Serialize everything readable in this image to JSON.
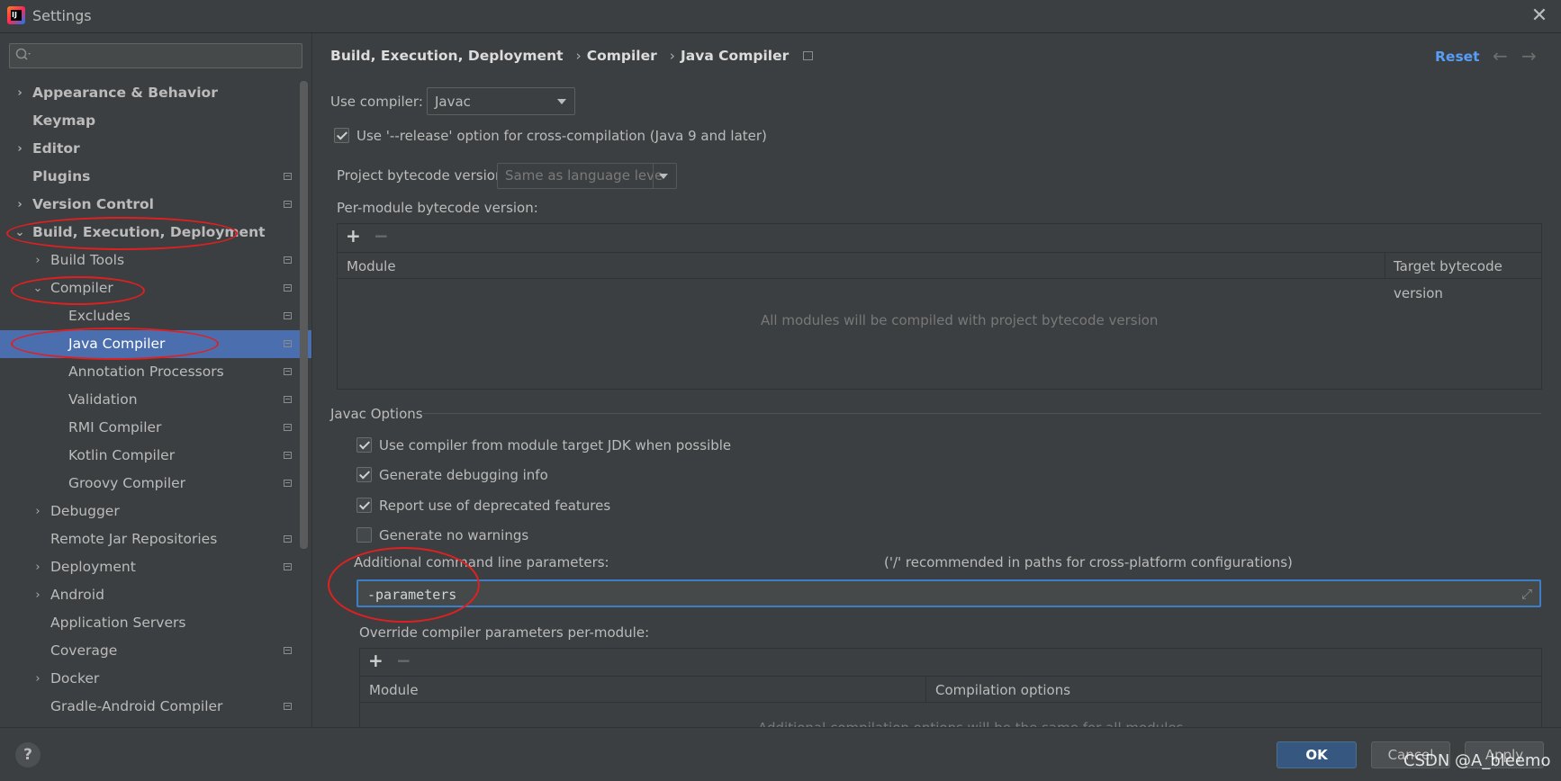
{
  "window": {
    "title": "Settings",
    "close_glyph": "✕",
    "app_icon_text": "IJ"
  },
  "search": {
    "value": "",
    "placeholder": "",
    "icon": "search-icon"
  },
  "sidebar": {
    "items": [
      {
        "label": "Appearance & Behavior",
        "chevron": "›"
      },
      {
        "label": "Keymap"
      },
      {
        "label": "Editor",
        "chevron": "›"
      },
      {
        "label": "Plugins"
      },
      {
        "label": "Version Control",
        "chevron": "›"
      },
      {
        "label": "Build, Execution, Deployment",
        "chevron": "⌄"
      },
      {
        "label": "Build Tools",
        "chevron": "›"
      },
      {
        "label": "Compiler",
        "chevron": "⌄"
      },
      {
        "label": "Excludes"
      },
      {
        "label": "Java Compiler"
      },
      {
        "label": "Annotation Processors"
      },
      {
        "label": "Validation"
      },
      {
        "label": "RMI Compiler"
      },
      {
        "label": "Kotlin Compiler"
      },
      {
        "label": "Groovy Compiler"
      },
      {
        "label": "Debugger",
        "chevron": "›"
      },
      {
        "label": "Remote Jar Repositories"
      },
      {
        "label": "Deployment",
        "chevron": "›"
      },
      {
        "label": "Android",
        "chevron": "›"
      },
      {
        "label": "Application Servers"
      },
      {
        "label": "Coverage"
      },
      {
        "label": "Docker",
        "chevron": "›"
      },
      {
        "label": "Gradle-Android Compiler"
      }
    ],
    "selected": "Java Compiler"
  },
  "breadcrumb": {
    "items": [
      "Build, Execution, Deployment",
      "Compiler",
      "Java Compiler"
    ],
    "separator": "›"
  },
  "header": {
    "reset_label": "Reset",
    "back_glyph": "←",
    "forward_glyph": "→"
  },
  "compiler": {
    "use_compiler_label": "Use compiler:",
    "use_compiler_value": "Javac",
    "release_option_label": "Use '--release' option for cross-compilation (Java 9 and later)",
    "release_option_checked": true,
    "bytecode_label": "Project bytecode version:",
    "bytecode_value": "Same as language leve",
    "per_module_label": "Per-module bytecode version:",
    "module_table": {
      "columns": [
        "Module",
        "Target bytecode version"
      ],
      "empty_text": "All modules will be compiled with project bytecode version"
    }
  },
  "javac": {
    "section_title": "Javac Options",
    "options": [
      {
        "label": "Use compiler from module target JDK when possible",
        "checked": true
      },
      {
        "label": "Generate debugging info",
        "checked": true
      },
      {
        "label": "Report use of deprecated features",
        "checked": true
      },
      {
        "label": "Generate no warnings",
        "checked": false
      }
    ],
    "params_label": "Additional command line parameters:",
    "params_hint": "('/' recommended in paths for cross-platform configurations)",
    "params_value": "-parameters",
    "override_label": "Override compiler parameters per-module:",
    "override_table": {
      "columns": [
        "Module",
        "Compilation options"
      ],
      "empty_text": "Additional compilation options will be the same for all modules"
    }
  },
  "toolbar": {
    "add_glyph": "+",
    "remove_glyph": "−"
  },
  "footer": {
    "help_glyph": "?",
    "ok_label": "OK",
    "cancel_label": "Cancel",
    "apply_label": "Apply"
  },
  "watermark": "CSDN @A_bleemo",
  "colors": {
    "accent": "#4b6eaf",
    "link": "#589df6",
    "annotation": "#e02020",
    "primary_button": "#365880"
  }
}
